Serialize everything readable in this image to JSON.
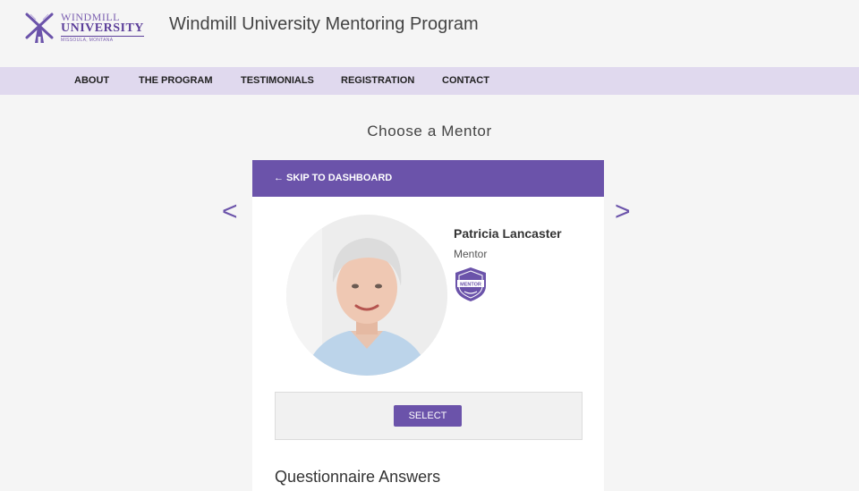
{
  "logo": {
    "line1": "WINDMILL",
    "line2": "UNIVERSITY",
    "line3": "MISSOULA, MONTANA"
  },
  "site_title": "Windmill University Mentoring Program",
  "nav": {
    "about": "ABOUT",
    "program": "THE PROGRAM",
    "testimonials": "TESTIMONIALS",
    "registration": "REGISTRATION",
    "contact": "CONTACT"
  },
  "page_heading": "Choose a Mentor",
  "card": {
    "skip_label": "← SKIP TO DASHBOARD",
    "mentor_name": "Patricia Lancaster",
    "mentor_role": "Mentor",
    "badge_text": "MENTOR",
    "select_label": "SELECT",
    "questionnaire_heading": "Questionnaire Answers"
  },
  "arrows": {
    "prev": "<",
    "next": ">"
  },
  "colors": {
    "accent": "#6b53aa",
    "nav_bg": "#e0d9ee",
    "page_bg": "#f5f5f5"
  },
  "icons": [
    "windmill-logo-icon",
    "mentor-badge-icon",
    "prev-arrow-icon",
    "next-arrow-icon"
  ]
}
